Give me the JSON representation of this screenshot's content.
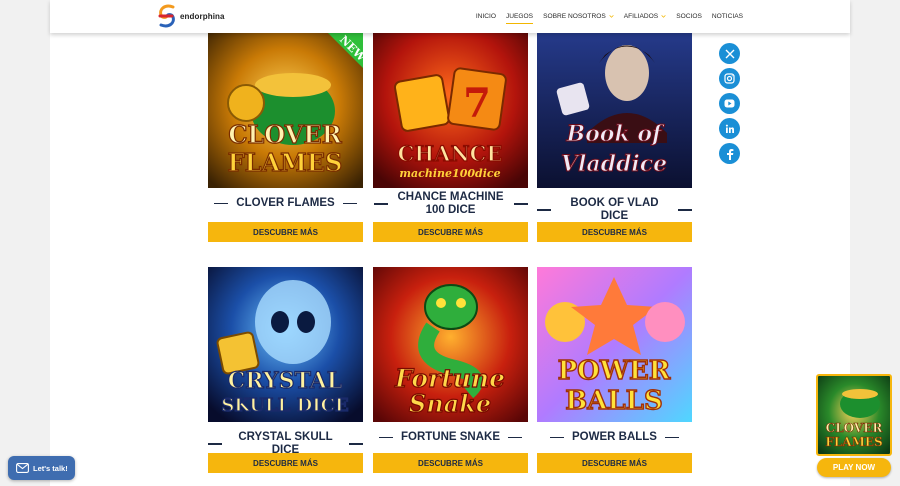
{
  "header": {
    "logo_text": "endorphina",
    "nav": [
      {
        "label": "INICIO",
        "active": false,
        "dropdown": false
      },
      {
        "label": "JUEGOS",
        "active": true,
        "dropdown": false
      },
      {
        "label": "SOBRE NOSOTROS",
        "active": false,
        "dropdown": true
      },
      {
        "label": "AFILIADOS",
        "active": false,
        "dropdown": true
      },
      {
        "label": "SOCIOS",
        "active": false,
        "dropdown": false
      },
      {
        "label": "NOTICIAS",
        "active": false,
        "dropdown": false
      }
    ]
  },
  "games": [
    {
      "title": "CLOVER FLAMES",
      "cta": "DESCUBRE MÁS",
      "art": [
        "CLOVER",
        "FLAMES"
      ],
      "badge": "NEW"
    },
    {
      "title": "CHANCE MACHINE 100 DICE",
      "cta": "DESCUBRE MÁS",
      "art": [
        "CHANCE",
        "machine100dice"
      ]
    },
    {
      "title": "BOOK OF VLAD DICE",
      "cta": "DESCUBRE MÁS",
      "art": [
        "Book of",
        "Vladdice"
      ]
    },
    {
      "title": "CRYSTAL SKULL DICE",
      "cta": "DESCUBRE MÁS",
      "art": [
        "CRYSTAL",
        "SKULL DICE"
      ]
    },
    {
      "title": "FORTUNE SNAKE",
      "cta": "DESCUBRE MÁS",
      "art": [
        "Fortune",
        "Snake"
      ]
    },
    {
      "title": "POWER BALLS",
      "cta": "DESCUBRE MÁS",
      "art": [
        "POWER",
        "BALLS"
      ]
    }
  ],
  "social": [
    "x-icon",
    "instagram-icon",
    "youtube-icon",
    "linkedin-icon",
    "facebook-icon"
  ],
  "chat": {
    "label": "Let's talk!"
  },
  "promo": {
    "art": [
      "CLOVER",
      "FLAMES"
    ],
    "button": "PLAY NOW"
  },
  "colors": {
    "accent": "#f6b60d",
    "title": "#1d2a44",
    "social": "#1a8fd6",
    "chat": "#3f6db0"
  }
}
